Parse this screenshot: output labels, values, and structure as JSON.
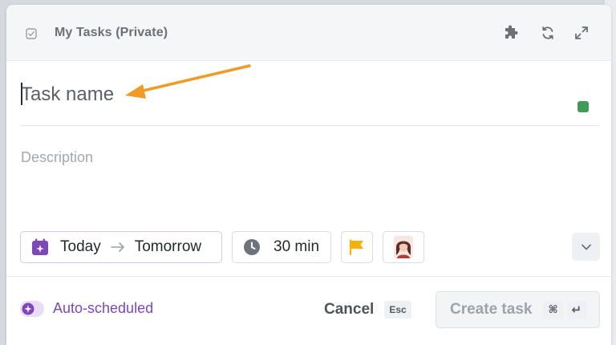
{
  "header": {
    "title": "My Tasks (Private)",
    "icons": [
      "checkbox-icon",
      "puzzle-icon",
      "sync-icon",
      "expand-icon"
    ]
  },
  "task": {
    "name_value": "",
    "name_placeholder": "Task name",
    "description_placeholder": "Description",
    "color": "#3f9b57"
  },
  "schedule": {
    "start": "Today",
    "end": "Tomorrow",
    "duration": "30 min",
    "priority_color": "#f5b00b"
  },
  "footer": {
    "auto_scheduled_label": "Auto-scheduled",
    "cancel_label": "Cancel",
    "cancel_shortcut": "Esc",
    "create_label": "Create task",
    "create_shortcut_mod": "⌘",
    "create_shortcut_key": "↵"
  },
  "colors": {
    "accent_purple": "#7d47b8",
    "annotation_arrow": "#f09a27"
  }
}
